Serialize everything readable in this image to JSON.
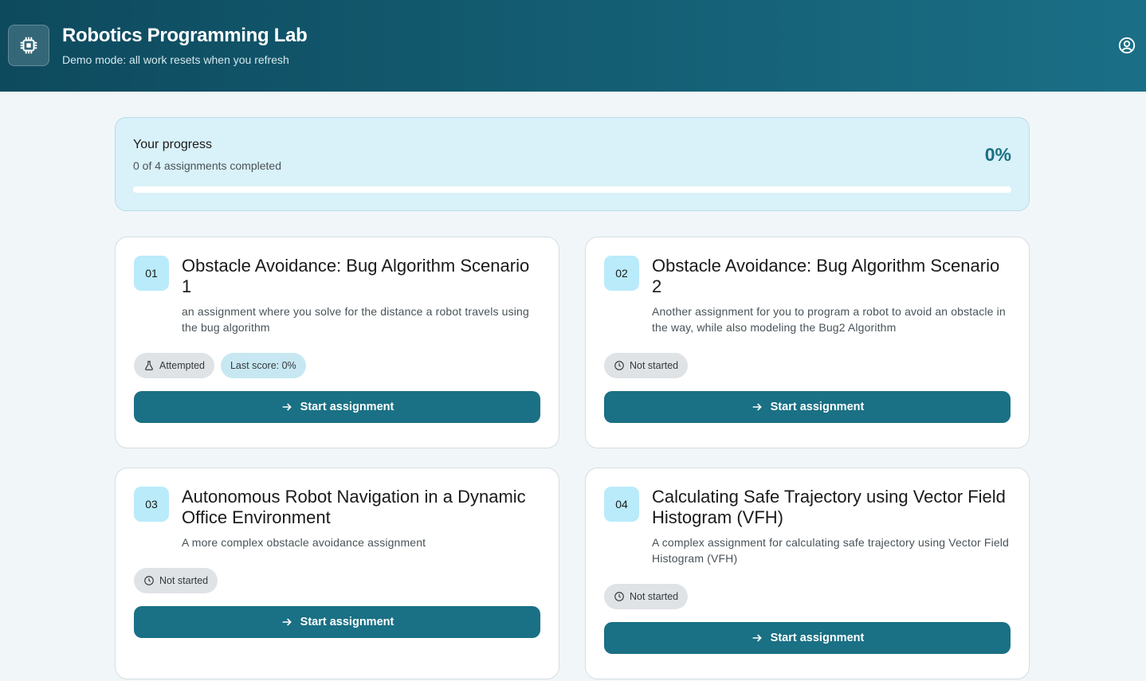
{
  "app": {
    "title": "Robotics Programming Lab",
    "subtitle": "Demo mode: all work resets when you refresh",
    "logo_icon": "chip-icon",
    "account_icon": "account-circle-icon"
  },
  "progress": {
    "title": "Your progress",
    "count_text": "0 of 4 assignments completed",
    "percent_label": "0%",
    "percent_value": 0
  },
  "colors": {
    "header_start": "#0e4a5e",
    "header_end": "#1a6f86",
    "accent": "#1a7084",
    "badge_bg": "#b9ebfb",
    "progress_card_bg": "#d9f1f8"
  },
  "assignments": [
    {
      "number": "01",
      "title": "Obstacle Avoidance: Bug Algorithm Scenario 1",
      "description": "an assignment where you solve for the distance a robot travels using the bug algorithm",
      "status": "Attempted",
      "status_icon": "flask-icon",
      "score_label": "Last score: 0%",
      "button_label": "Start assignment"
    },
    {
      "number": "02",
      "title": "Obstacle Avoidance: Bug Algorithm Scenario 2",
      "description": "Another assignment for you to program a robot to avoid an obstacle in the way, while also modeling the Bug2 Algorithm",
      "status": "Not started",
      "status_icon": "clock-icon",
      "button_label": "Start assignment"
    },
    {
      "number": "03",
      "title": "Autonomous Robot Navigation in a Dynamic Office Environment",
      "description": "A more complex obstacle avoidance assignment",
      "status": "Not started",
      "status_icon": "clock-icon",
      "button_label": "Start assignment"
    },
    {
      "number": "04",
      "title": "Calculating Safe Trajectory using Vector Field Histogram (VFH)",
      "description": "A complex assignment for calculating safe trajectory using Vector Field Histogram (VFH)",
      "status": "Not started",
      "status_icon": "clock-icon",
      "button_label": "Start assignment"
    }
  ]
}
